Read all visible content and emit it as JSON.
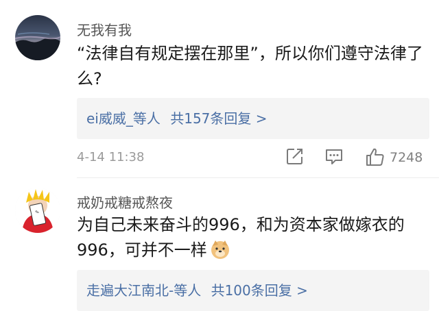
{
  "comments": [
    {
      "username": "无我有我",
      "text": "“法律自有规定摆在那里”，所以你们遵守法律了么?",
      "replies": {
        "names": "ei威威_等人",
        "count_text": "共157条回复 >"
      },
      "time": "4-14 11:38",
      "like_count": "7248",
      "icons": [
        "share-icon",
        "comment-icon",
        "like-icon"
      ]
    },
    {
      "username": "戒奶戒糖戒熬夜",
      "text": "为自己未来奋斗的996，和为资本家做嫁衣的996，可并不一样",
      "emoji": "doge-emoji",
      "replies": {
        "names": "走遍大江南北-等人",
        "count_text": "共100条回复 >"
      }
    }
  ],
  "colors": {
    "link": "#4a6fa5",
    "meta": "#9a9a9a",
    "reply_bg": "#f4f4f4"
  }
}
